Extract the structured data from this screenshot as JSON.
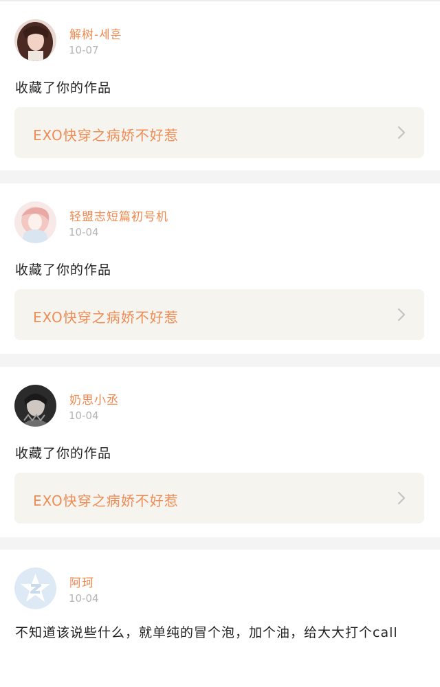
{
  "notifications": [
    {
      "user": "解树-세훈",
      "time": "10-07",
      "action": "收藏了你的作品",
      "work_title": "EXO快穿之病娇不好惹"
    },
    {
      "user": "轻盟志短篇初号机",
      "time": "10-04",
      "action": "收藏了你的作品",
      "work_title": "EXO快穿之病娇不好惹"
    },
    {
      "user": "奶思小丞",
      "time": "10-04",
      "action": "收藏了你的作品",
      "work_title": "EXO快穿之病娇不好惹"
    },
    {
      "user": "阿珂",
      "time": "10-04",
      "comment": "不知道该说些什么，就单纯的冒个泡，加个油，给大大打个call"
    }
  ],
  "colors": {
    "username": "#f0884e",
    "work_title": "#ef8c55",
    "time": "#b5b5b5",
    "work_bg": "#f5f4ef",
    "divider": "#f4f4f4"
  },
  "icons": {
    "chevron": "chevron-right-icon",
    "default_avatar": "qq-default-avatar-icon"
  }
}
